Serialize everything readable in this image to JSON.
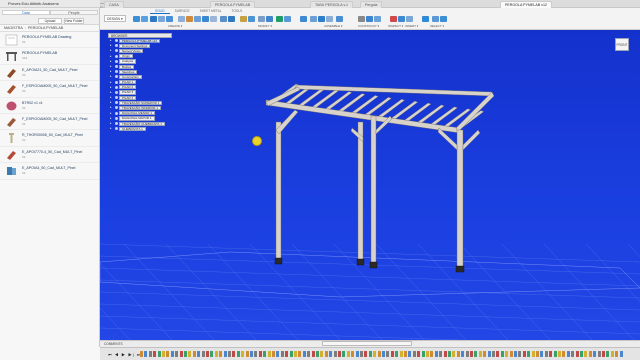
{
  "app": {
    "title": "Proves Edu Aitiletk Analsens",
    "window_buttons": [
      "—",
      "□",
      "✕"
    ]
  },
  "doc_tabs": [
    {
      "label": "CASA",
      "active": false
    },
    {
      "label": "PERGOLA PYMELAB",
      "active": false
    },
    {
      "label": "TABU PERGOLA v.1",
      "active": false
    },
    {
      "label": "Pergola",
      "active": false
    },
    {
      "label": "PERGOLA PYMELAB v12",
      "active": true
    }
  ],
  "data_panel": {
    "tabs": [
      {
        "label": "Data",
        "active": true
      },
      {
        "label": "People",
        "active": false
      }
    ],
    "upload_label": "Upload",
    "new_folder_label": "New Folder",
    "breadcrumb": [
      "MAGISTRA",
      "PERGOLA PYMELAB"
    ],
    "items": [
      {
        "name": "PERGOLA PYMELAB Drawing",
        "version": "V1",
        "thumb": "drawing",
        "color": "#d9d9d9"
      },
      {
        "name": "PERGOLA PYMELAB",
        "version": "V12",
        "thumb": "pergola",
        "color": "#555555"
      },
      {
        "name": "E_APOIA21_50_Cad_MULT_Pinei",
        "version": "V1",
        "thumb": "post",
        "color": "#8a4a2a"
      },
      {
        "name": "F_ESPIGOAM005_50_Cad_MULT_Pinei",
        "version": "V1",
        "thumb": "beam",
        "color": "#a3512d"
      },
      {
        "name": "BTR02 v1 v1",
        "version": "V1",
        "thumb": "cap",
        "color": "#c05070"
      },
      {
        "name": "F_ESPIGOAM005_50_Cad_MULT_Pinei",
        "version": "V1",
        "thumb": "beam",
        "color": "#9a5a3a"
      },
      {
        "name": "R_THOR00006_50_Cad_MULT_Pinei",
        "version": "V1",
        "thumb": "screw",
        "color": "#b9b08a"
      },
      {
        "name": "E_APOI7770-4_50_Cad_MULT_Pinei",
        "version": "V1",
        "thumb": "bracket",
        "color": "#b34b3a"
      },
      {
        "name": "E_APOIA4_50_Cad_MULT_Pinei",
        "version": "V1",
        "thumb": "plate",
        "color": "#3a7ab0"
      }
    ]
  },
  "toolbar": {
    "workspace_tabs": [
      {
        "label": "SOLID",
        "active": true
      },
      {
        "label": "SURFACE",
        "active": false
      },
      {
        "label": "SHEET METAL",
        "active": false
      },
      {
        "label": "TOOLS",
        "active": false
      }
    ],
    "design_label": "DESIGN ▾",
    "groups": [
      "CREATE ▾",
      "MODIFY ▾",
      "ASSEMBLE ▾",
      "CONSTRUCT ▾",
      "INSPECT ▾",
      "INSERT ▾",
      "SELECT ▾"
    ]
  },
  "browser": {
    "header": "BROWSER",
    "rows": [
      {
        "label": "PERGOLA PYMELAB v12",
        "root": true
      },
      {
        "label": "Document Settings"
      },
      {
        "label": "Named Views"
      },
      {
        "label": "Origin"
      },
      {
        "label": "Analysis"
      },
      {
        "label": "Bodies"
      },
      {
        "label": "Sketches"
      },
      {
        "label": "Construction"
      },
      {
        "label": "PILAR 1"
      },
      {
        "label": "PILAR 2"
      },
      {
        "label": "PILAR 3"
      },
      {
        "label": "PILAR 4"
      },
      {
        "label": "TRAVESAÑO SUPERIOR 1"
      },
      {
        "label": "TRAVESAÑO INFERIOR 1"
      },
      {
        "label": "DIAGONAL MENOR 1"
      },
      {
        "label": "DIAGONAL MAYOR 1"
      },
      {
        "label": "TRAVESAÑO QUEBRANTA 1"
      },
      {
        "label": "QUEBRANTA 1"
      }
    ]
  },
  "viewcube": {
    "face_label": "FRONT"
  },
  "comments_label": "COMMENTS",
  "timeline_controls": "⏮ ◀ ▶ ▶| ⏭",
  "colors": {
    "viewport_top": "#1431cc",
    "viewport_bottom": "#2346e6",
    "accent": "#1b6fc0",
    "timber": "#d7d2ca"
  }
}
